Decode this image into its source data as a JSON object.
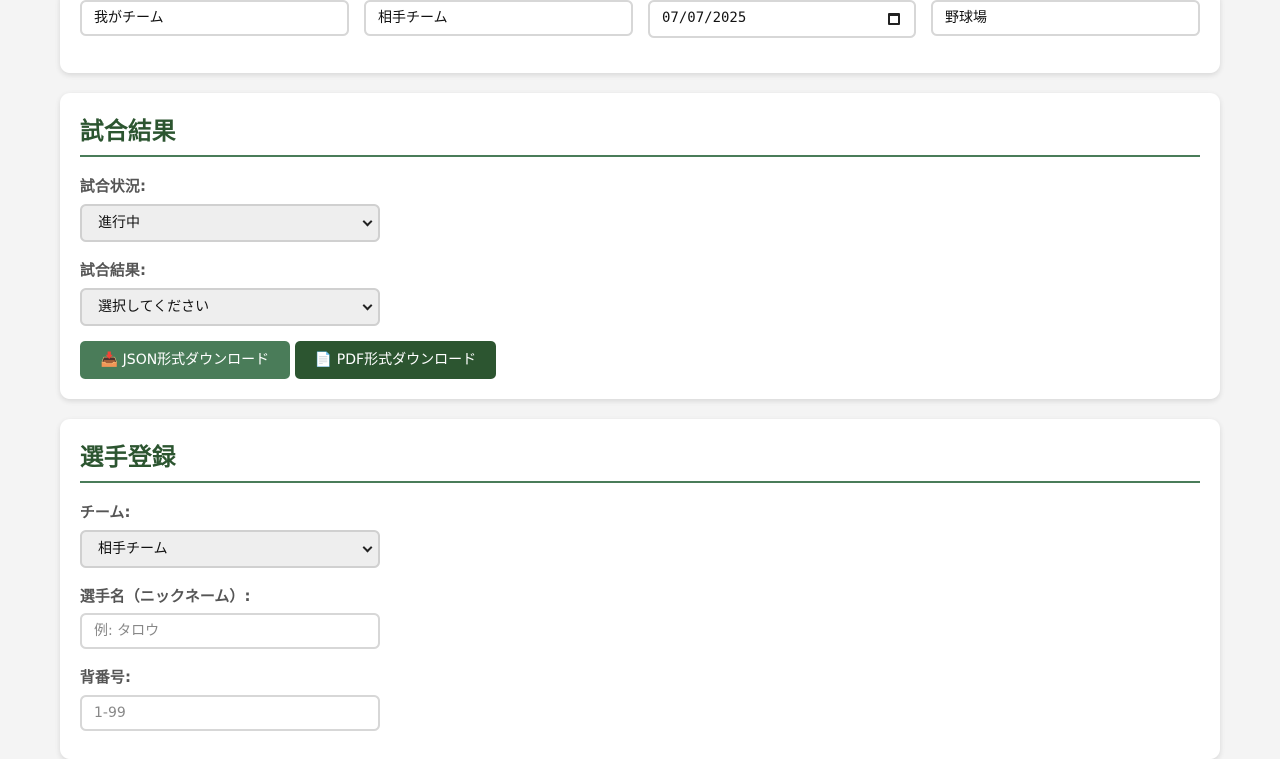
{
  "match_info": {
    "home_team": "我がチーム",
    "away_team": "相手チーム",
    "date": "07/07/2025",
    "venue": "野球場"
  },
  "result_section": {
    "title": "試合結果",
    "status_label": "試合状況:",
    "status_value": "進行中",
    "result_label": "試合結果:",
    "result_value": "選択してください",
    "json_button": "📥 JSON形式ダウンロード",
    "pdf_button": "📄 PDF形式ダウンロード"
  },
  "player_section": {
    "title": "選手登録",
    "team_label": "チーム:",
    "team_value": "相手チーム",
    "name_label": "選手名（ニックネーム）:",
    "name_placeholder": "例: タロウ",
    "number_label": "背番号:",
    "number_placeholder": "1-99"
  },
  "colors": {
    "primary": "#2c5530",
    "accent": "#4a7c59",
    "background": "#f4f4f4"
  }
}
